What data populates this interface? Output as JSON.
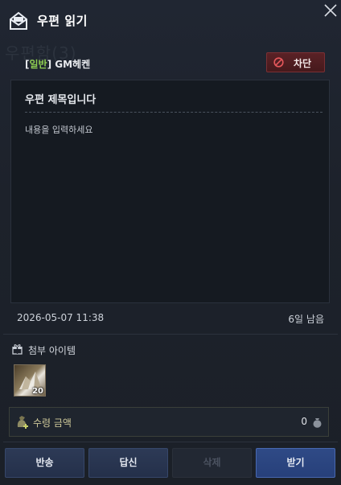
{
  "window": {
    "title": "우편 읽기",
    "background_text": "우편함(3)"
  },
  "sender": {
    "category": "일반",
    "name": "GM헤켄"
  },
  "block_button": {
    "label": "차단"
  },
  "message": {
    "subject": "우편 제목입니다",
    "body": "내용을 입력하세요"
  },
  "meta": {
    "date": "2026-05-07 11:38",
    "remaining": "6일 남음"
  },
  "attachments": {
    "label": "첨부 아이템",
    "items": [
      {
        "icon": "crystal-ore-icon",
        "count": "20"
      }
    ]
  },
  "amount": {
    "label": "수령 금액",
    "value": "0"
  },
  "buttons": {
    "return": "반송",
    "reply": "답신",
    "delete": "삭제",
    "receive": "받기"
  },
  "colors": {
    "accent_green": "#8fcf52",
    "block_red": "#5a2226",
    "primary_blue": "#2f4a86"
  }
}
